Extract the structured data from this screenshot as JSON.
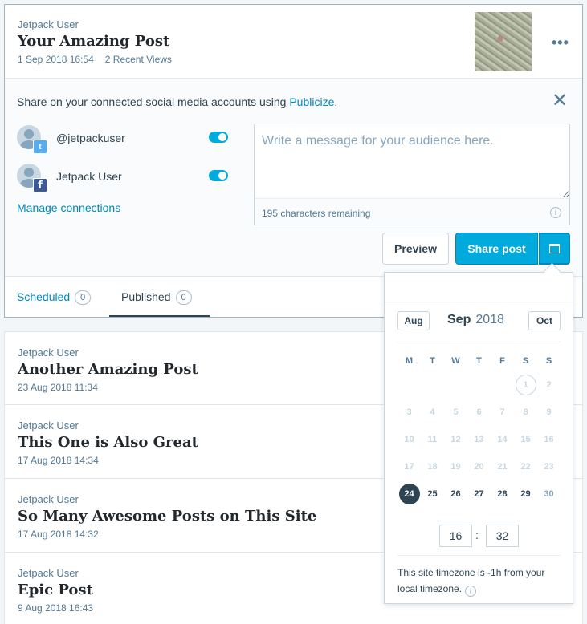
{
  "main_post": {
    "author": "Jetpack User",
    "title": "Your Amazing Post",
    "date": "1 Sep 2018 16:54",
    "views": "2 Recent Views",
    "more": "•••"
  },
  "share": {
    "intro_text": "Share on your connected social media accounts using",
    "intro_link": "Publicize",
    "intro_end": ".",
    "close": "✕",
    "connections": [
      {
        "name": "@jetpackuser",
        "service": "twitter",
        "badge": "t",
        "enabled": true
      },
      {
        "name": "Jetpack User",
        "service": "facebook",
        "badge": "f",
        "enabled": true
      }
    ],
    "manage": "Manage connections",
    "message_placeholder": "Write a message for your audience here.",
    "chars_remaining": "195 characters remaining",
    "info": "i",
    "preview": "Preview",
    "share_post": "Share post"
  },
  "tabs": {
    "scheduled": {
      "label": "Scheduled",
      "count": "0"
    },
    "published": {
      "label": "Published",
      "count": "0"
    }
  },
  "posts": [
    {
      "author": "Jetpack User",
      "title": "Another Amazing Post",
      "date": "23 Aug 2018 11:34"
    },
    {
      "author": "Jetpack User",
      "title": "This One is Also Great",
      "date": "17 Aug 2018 14:34"
    },
    {
      "author": "Jetpack User",
      "title": "So Many Awesome Posts on This Site",
      "date": "17 Aug 2018 14:32"
    },
    {
      "author": "Jetpack User",
      "title": "Epic Post",
      "date": "9 Aug 2018 16:43"
    }
  ],
  "calendar": {
    "prev": "Aug",
    "next": "Oct",
    "month": "Sep",
    "year": "2018",
    "weekdays": [
      "M",
      "T",
      "W",
      "T",
      "F",
      "S",
      "S"
    ],
    "weeks": [
      [
        [
          "",
          ""
        ],
        [
          "",
          ""
        ],
        [
          "",
          ""
        ],
        [
          "",
          ""
        ],
        [
          "",
          ""
        ],
        [
          "1",
          "today"
        ],
        [
          "2",
          "past"
        ]
      ],
      [
        [
          "3",
          "past"
        ],
        [
          "4",
          "past"
        ],
        [
          "5",
          "past"
        ],
        [
          "6",
          "past"
        ],
        [
          "7",
          "past"
        ],
        [
          "8",
          "past"
        ],
        [
          "9",
          "past"
        ]
      ],
      [
        [
          "10",
          "past"
        ],
        [
          "11",
          "past"
        ],
        [
          "12",
          "past"
        ],
        [
          "13",
          "past"
        ],
        [
          "14",
          "past"
        ],
        [
          "15",
          "past"
        ],
        [
          "16",
          "past"
        ]
      ],
      [
        [
          "17",
          "past"
        ],
        [
          "18",
          "past"
        ],
        [
          "19",
          "past"
        ],
        [
          "20",
          "past"
        ],
        [
          "21",
          "past"
        ],
        [
          "22",
          "past"
        ],
        [
          "23",
          "past"
        ]
      ],
      [
        [
          "24",
          "selected"
        ],
        [
          "25",
          "active"
        ],
        [
          "26",
          "active"
        ],
        [
          "27",
          "active"
        ],
        [
          "28",
          "active"
        ],
        [
          "29",
          "active"
        ],
        [
          "30",
          "weekend"
        ]
      ]
    ],
    "hour": "16",
    "minute": "32",
    "separator": ":",
    "timezone_note": "This site timezone is -1h from your local timezone."
  },
  "colors": {
    "accent": "#00aadc",
    "link": "#0087be",
    "text": "#2e4453"
  }
}
